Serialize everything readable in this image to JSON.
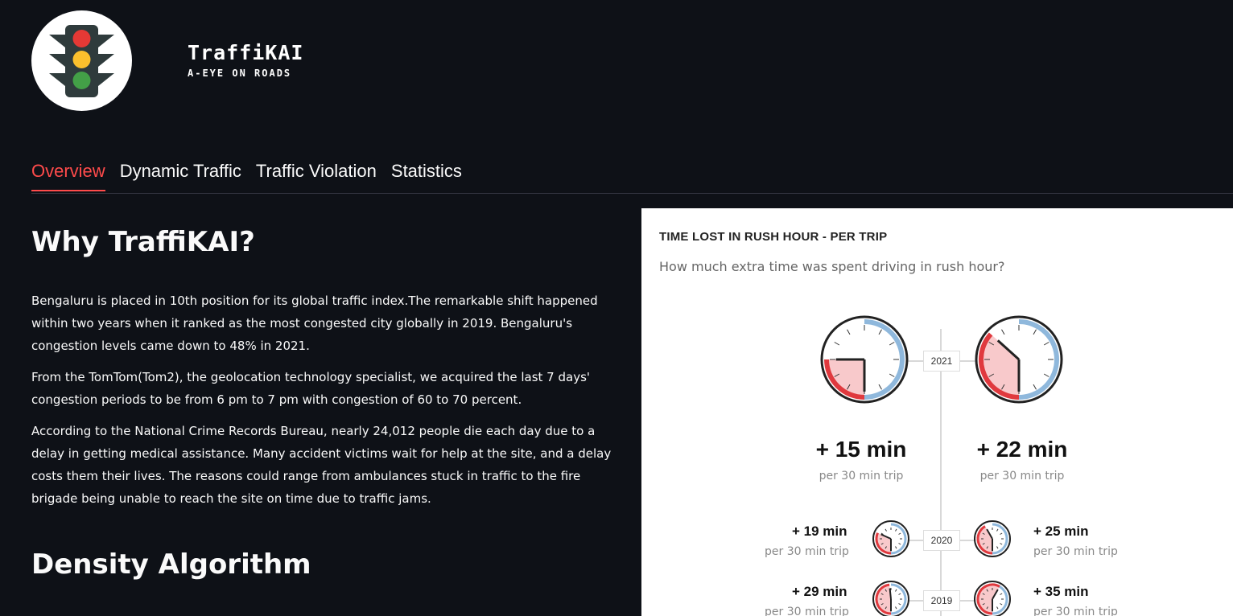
{
  "app": {
    "title": "TraffiKAI",
    "tagline": "A-EYE ON ROADS",
    "logo_icon": "traffic-light-icon"
  },
  "tabs": [
    {
      "label": "Overview",
      "active": true
    },
    {
      "label": "Dynamic Traffic",
      "active": false
    },
    {
      "label": "Traffic Violation",
      "active": false
    },
    {
      "label": "Statistics",
      "active": false
    }
  ],
  "main": {
    "heading": "Why TraffiKAI?",
    "paragraphs": [
      "Bengaluru is placed in 10th position for its global traffic index.The remarkable shift happened within two years when it ranked as the most congested city globally in 2019. Bengaluru's congestion levels came down to 48% in 2021.",
      "From the TomTom(Tom2), the geolocation technology specialist, we acquired the last 7 days' congestion periods to be from 6 pm to 7 pm with congestion of 60 to 70 percent.",
      "According to the National Crime Records Bureau, nearly 24,012 people die each day due to a delay in getting medical assistance. Many accident victims wait for help at the site, and a delay costs them their lives. The reasons could range from ambulances stuck in traffic to the fire brigade being unable to reach the site on time due to traffic jams."
    ],
    "heading2": "Density Algorithm"
  },
  "infographic": {
    "title": "TIME LOST IN RUSH HOUR - PER TRIP",
    "subtitle": "How much extra time was spent driving in rush hour?",
    "per_trip": "per 30 min trip",
    "colors": {
      "accent": "#e0393e",
      "fill": "#f8c9cb",
      "blue": "#8fb8dc"
    },
    "years": [
      {
        "year": "2021",
        "left": "+ 15 min",
        "right": "+ 22 min",
        "left_minutes": 15,
        "right_minutes": 22
      },
      {
        "year": "2020",
        "left": "+ 19 min",
        "right": "+ 25 min",
        "left_minutes": 19,
        "right_minutes": 25
      },
      {
        "year": "2019",
        "left": "+ 29 min",
        "right": "+ 35 min",
        "left_minutes": 29,
        "right_minutes": 35
      }
    ]
  }
}
